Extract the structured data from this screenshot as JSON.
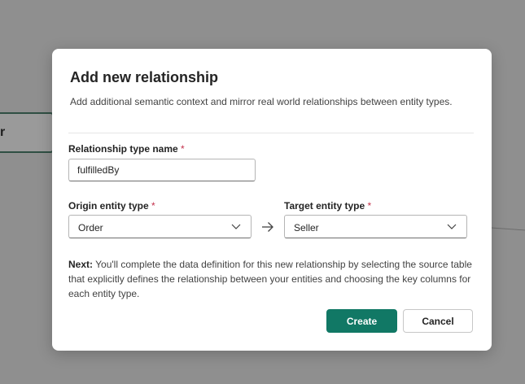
{
  "background": {
    "node_label": "r"
  },
  "dialog": {
    "title": "Add new relationship",
    "description": "Add additional semantic context and mirror real world relationships between entity types.",
    "relationship_name": {
      "label": "Relationship type name",
      "required_mark": "*",
      "value": "fulfilledBy"
    },
    "origin": {
      "label": "Origin entity type",
      "required_mark": "*",
      "value": "Order"
    },
    "target": {
      "label": "Target entity type",
      "required_mark": "*",
      "value": "Seller"
    },
    "note": {
      "prefix": "Next:",
      "text": "You'll complete the data definition for this new relationship by selecting the source table that explicitly defines the relationship between your entities and choosing the key columns for each entity type."
    },
    "buttons": {
      "create": "Create",
      "cancel": "Cancel"
    }
  },
  "colors": {
    "primary": "#117865",
    "required": "#c4314b",
    "overlay": "#8f8f8f"
  },
  "icons": {
    "origin_dropdown": "chevron-down-icon",
    "target_dropdown": "chevron-down-icon",
    "relation_arrow": "arrow-right-icon"
  }
}
